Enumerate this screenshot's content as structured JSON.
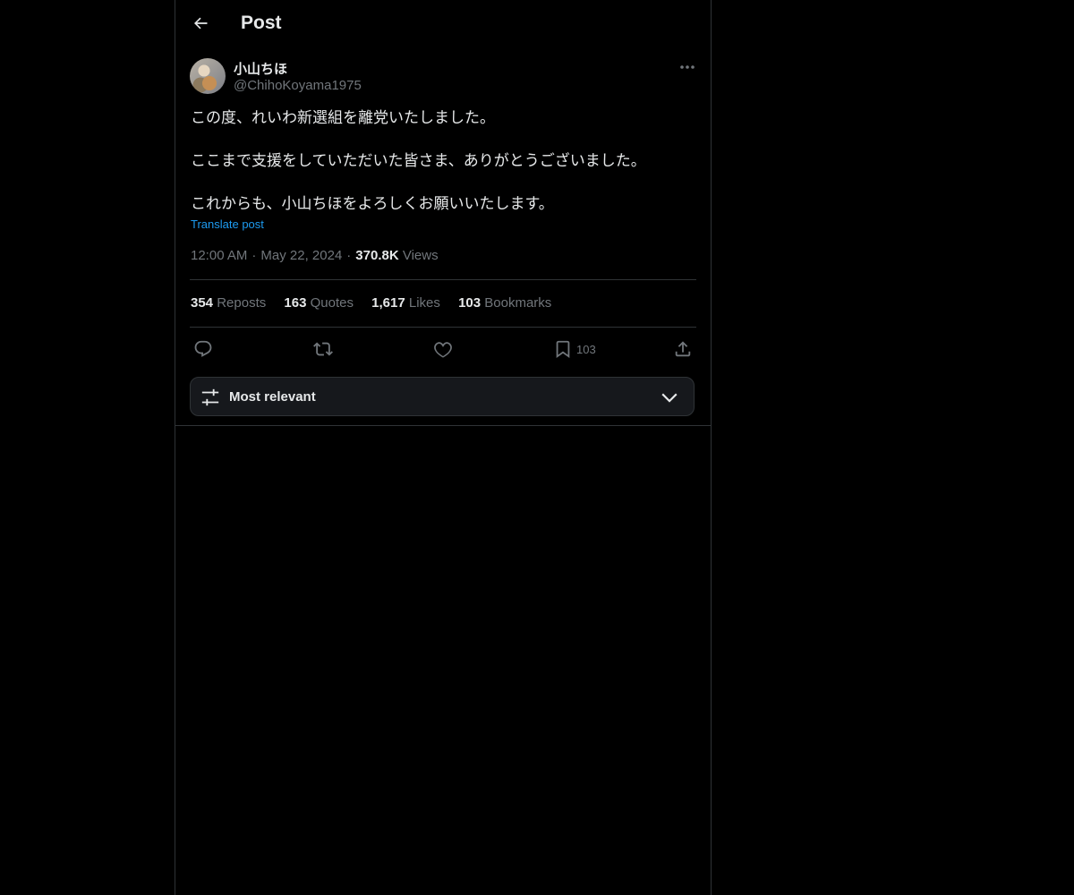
{
  "header": {
    "title": "Post",
    "back_icon": "arrow-left-icon"
  },
  "author": {
    "display_name": "小山ちほ",
    "handle": "@ChihoKoyama1975"
  },
  "post": {
    "lines": [
      "この度、れいわ新選組を離党いたしました。",
      "ここまで支援をしていただいた皆さま、ありがとうございました。",
      "これからも、小山ちほをよろしくお願いいたします。"
    ],
    "translate_label": "Translate post",
    "time": "12:00 AM",
    "date": "May 22, 2024",
    "views_count": "370.8K",
    "views_label": "Views"
  },
  "stats": {
    "reposts": {
      "count": "354",
      "label": "Reposts"
    },
    "quotes": {
      "count": "163",
      "label": "Quotes"
    },
    "likes": {
      "count": "1,617",
      "label": "Likes"
    },
    "bookmarks": {
      "count": "103",
      "label": "Bookmarks"
    }
  },
  "actions": {
    "reply_icon": "reply-icon",
    "repost_icon": "repost-icon",
    "like_icon": "heart-icon",
    "bookmark_icon": "bookmark-icon",
    "bookmark_count": "103",
    "share_icon": "share-icon"
  },
  "sort": {
    "label": "Most relevant",
    "icon": "sliders-icon",
    "chevron": "chevron-down-icon"
  },
  "colors": {
    "background": "#000000",
    "text": "#e7e9ea",
    "muted": "#71767b",
    "link": "#1d9bf0",
    "border": "#2f3336",
    "sort_bar_bg": "#16181c"
  }
}
